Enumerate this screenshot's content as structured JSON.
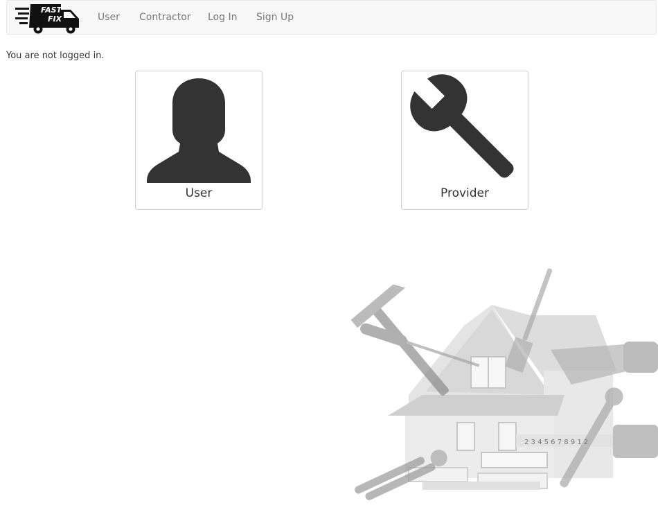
{
  "nav": {
    "logo_line1": "FAST",
    "logo_line2": "FIX",
    "links": [
      "User",
      "Contractor",
      "Log In",
      "Sign Up"
    ]
  },
  "status_text": "You are not logged in.",
  "cards": {
    "user_label": "User",
    "provider_label": "Provider"
  },
  "illustration": {
    "ruler_digits": "2 3 4 5 6 7 8 9 1 2"
  },
  "colors": {
    "navbar_bg": "#f8f8f8",
    "link": "#777777",
    "icon": "#333333",
    "illustration": "#c8c8c8"
  },
  "icons": [
    "truck-icon",
    "user-silhouette-icon",
    "wrench-icon"
  ]
}
